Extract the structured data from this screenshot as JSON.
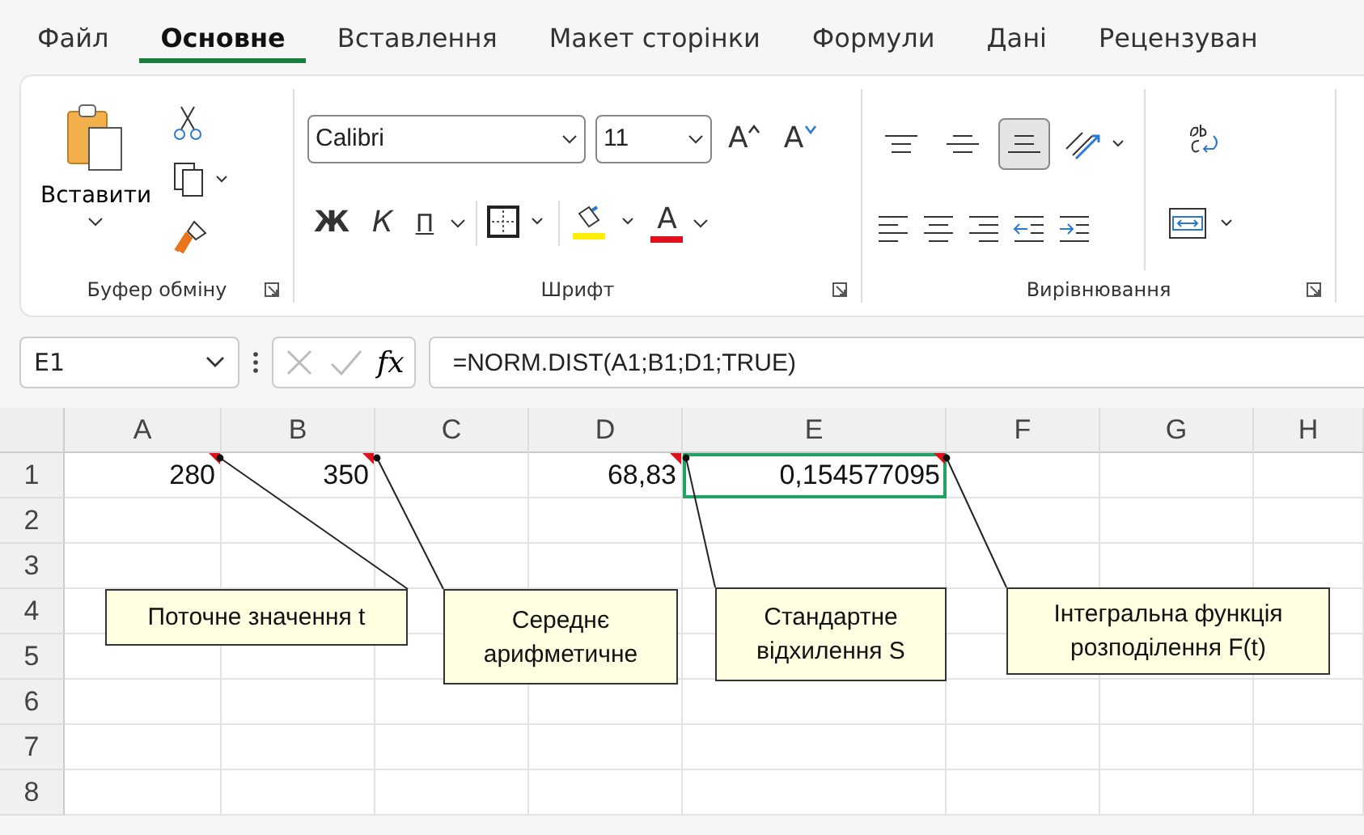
{
  "tabs": [
    {
      "label": "Файл",
      "selected": false
    },
    {
      "label": "Основне",
      "selected": true
    },
    {
      "label": "Вставлення",
      "selected": false
    },
    {
      "label": "Макет сторінки",
      "selected": false
    },
    {
      "label": "Формули",
      "selected": false
    },
    {
      "label": "Дані",
      "selected": false
    },
    {
      "label": "Рецензуван",
      "selected": false
    }
  ],
  "ribbon": {
    "clipboard": {
      "paste_label": "Вставити",
      "group_label": "Буфер обміну"
    },
    "font": {
      "font_name": "Calibri",
      "font_size": "11",
      "grow": "A",
      "shrink": "A",
      "bold": "Ж",
      "italic": "К",
      "underline": "П",
      "font_color": "A",
      "group_label": "Шрифт"
    },
    "alignment": {
      "vertical": [
        {
          "selected": false
        },
        {
          "selected": false
        },
        {
          "selected": true
        }
      ],
      "group_label": "Вирівнювання"
    }
  },
  "formula_bar": {
    "name_box": "E1",
    "fx": "fx",
    "formula": "=NORM.DIST(A1;B1;D1;TRUE)"
  },
  "columns": [
    "A",
    "B",
    "C",
    "D",
    "E",
    "F",
    "G",
    "H"
  ],
  "rows": [
    {
      "label": "1",
      "cells": [
        {
          "kind": "number",
          "value": "280",
          "comment": true,
          "selected": false
        },
        {
          "kind": "number",
          "value": "350",
          "comment": true,
          "selected": false
        },
        {
          "kind": "empty",
          "comment": false,
          "selected": false
        },
        {
          "kind": "number",
          "value": "68,83",
          "comment": true,
          "selected": false
        },
        {
          "kind": "number",
          "value": "0,154577095",
          "comment": true,
          "selected": true
        },
        {
          "kind": "empty",
          "comment": false,
          "selected": false
        },
        {
          "kind": "empty",
          "comment": false,
          "selected": false
        },
        {
          "kind": "empty",
          "comment": false,
          "selected": false
        }
      ]
    },
    {
      "label": "2"
    },
    {
      "label": "3"
    },
    {
      "label": "4"
    },
    {
      "label": "5"
    },
    {
      "label": "6"
    },
    {
      "label": "7"
    },
    {
      "label": "8"
    }
  ],
  "comments": [
    {
      "text": "Поточне значення t"
    },
    {
      "text": "Середнє арифметичне"
    },
    {
      "text": "Стандартне відхилення S"
    },
    {
      "text": "Інтегральна функція розподілення F(t)"
    }
  ]
}
